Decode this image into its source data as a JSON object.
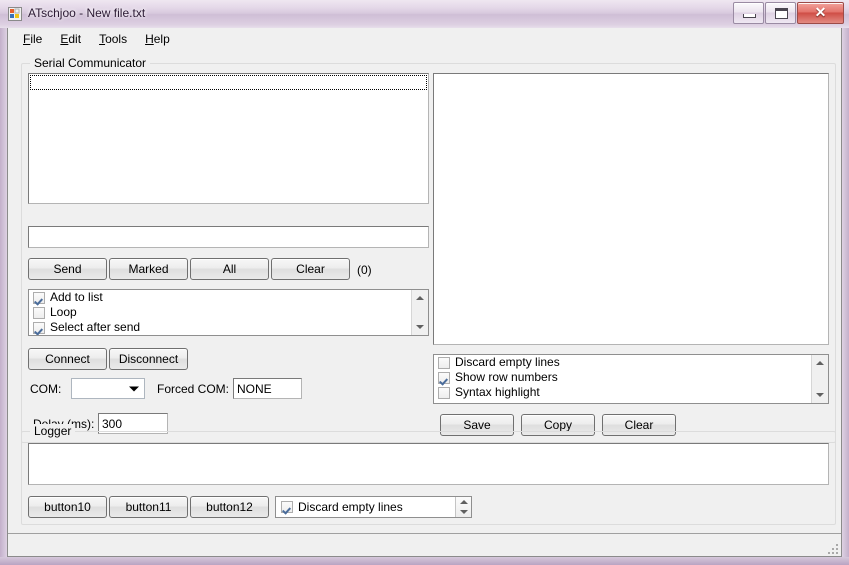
{
  "window": {
    "title": "ATschjoo - New file.txt",
    "icon": "app-form-icon",
    "minimize_label": "",
    "maximize_label": "",
    "close_label": "✕"
  },
  "menu": {
    "items": [
      {
        "mnemonic": "F",
        "rest": "ile"
      },
      {
        "mnemonic": "E",
        "rest": "dit"
      },
      {
        "mnemonic": "T",
        "rest": "ools"
      },
      {
        "mnemonic": "H",
        "rest": "elp"
      }
    ]
  },
  "serial_group": {
    "title": "Serial Communicator",
    "command_list": {
      "value": "",
      "focused_row": true
    },
    "command_input": {
      "value": "",
      "placeholder": ""
    },
    "buttons": {
      "send": "Send",
      "marked": "Marked",
      "all": "All",
      "clear": "Clear"
    },
    "counter": "(0)",
    "options": [
      {
        "label": "Add to list",
        "checked": true
      },
      {
        "label": "Loop",
        "checked": false
      },
      {
        "label": "Select after send",
        "checked": true
      }
    ],
    "connect_button": "Connect",
    "disconnect_button": "Disconnect",
    "com_label": "COM:",
    "com_value": "",
    "forced_com_label": "Forced COM:",
    "forced_com_value": "NONE",
    "delay_label": "Delay (ms):",
    "delay_value": "300"
  },
  "output_panel": {
    "text": "",
    "options": [
      {
        "label": "Discard empty lines",
        "checked": false
      },
      {
        "label": "Show row numbers",
        "checked": true
      },
      {
        "label": "Syntax highlight",
        "checked": false
      }
    ],
    "buttons": {
      "save": "Save",
      "copy": "Copy",
      "clear": "Clear"
    }
  },
  "logger_group": {
    "title": "Logger",
    "text": "",
    "buttons": {
      "button10": "button10",
      "button11": "button11",
      "button12": "button12"
    },
    "option": {
      "label": "Discard empty lines",
      "checked": true
    }
  },
  "statusbar": {
    "text": ""
  },
  "colors": {
    "window_face": "#f0f0f0",
    "field_bg": "#ffffff",
    "glass": "#cfc0d6",
    "close_red": "#cf4e46",
    "check_blue": "#4a6c9b"
  }
}
